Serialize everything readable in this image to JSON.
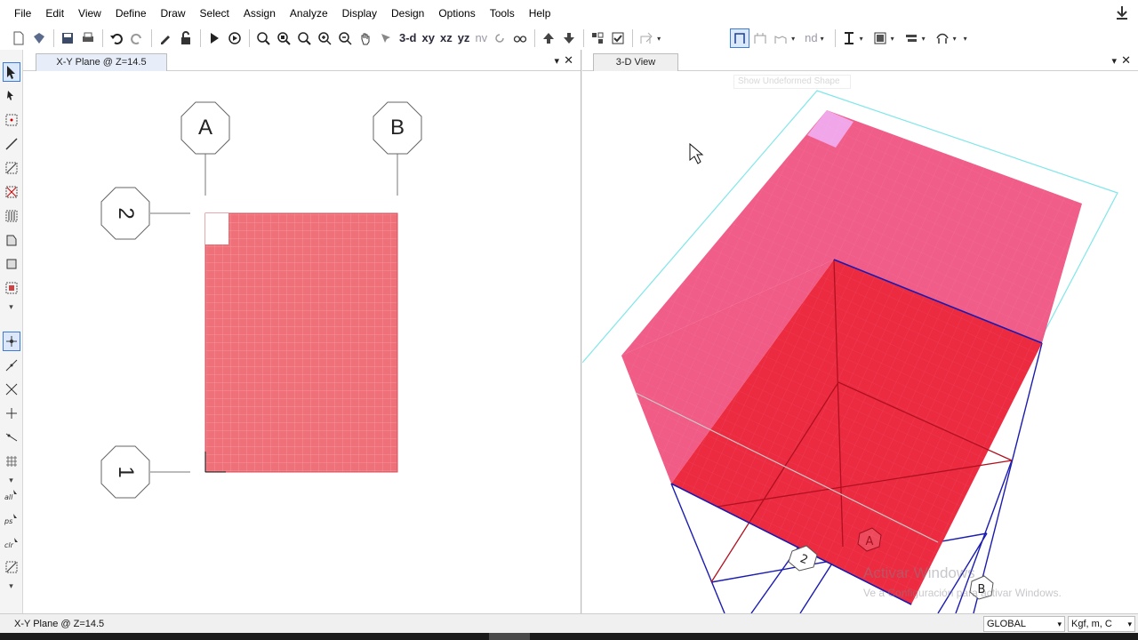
{
  "menu": [
    "File",
    "Edit",
    "View",
    "Define",
    "Draw",
    "Select",
    "Assign",
    "Analyze",
    "Display",
    "Design",
    "Options",
    "Tools",
    "Help"
  ],
  "toolbar": {
    "view_3d": "3-d",
    "view_xy": "xy",
    "view_xz": "xz",
    "view_yz": "yz",
    "view_nv": "nv",
    "nd": "nd"
  },
  "left_panel": {
    "tab_title": "X-Y Plane @ Z=14.5",
    "grid_bubbles": [
      "A",
      "B",
      "2",
      "1"
    ]
  },
  "right_panel": {
    "tab_title": "3-D View",
    "tooltip": "Show Undeformed Shape",
    "bubble_labels": [
      "A",
      "2",
      "B"
    ],
    "watermark_title": "Activar Windows",
    "watermark_text": "Ve a Configuración para activar Windows."
  },
  "status": {
    "text": "X-Y Plane @ Z=14.5",
    "coord_system": "GLOBAL",
    "units": "Kgf, m, C"
  },
  "colors": {
    "slab_fill": "#f07079",
    "wall_fill": "#ef4f7e",
    "slab_red": "#ec2b41",
    "frame_blue": "#1a1ab0",
    "grid_cyan": "#7fe6ea"
  }
}
